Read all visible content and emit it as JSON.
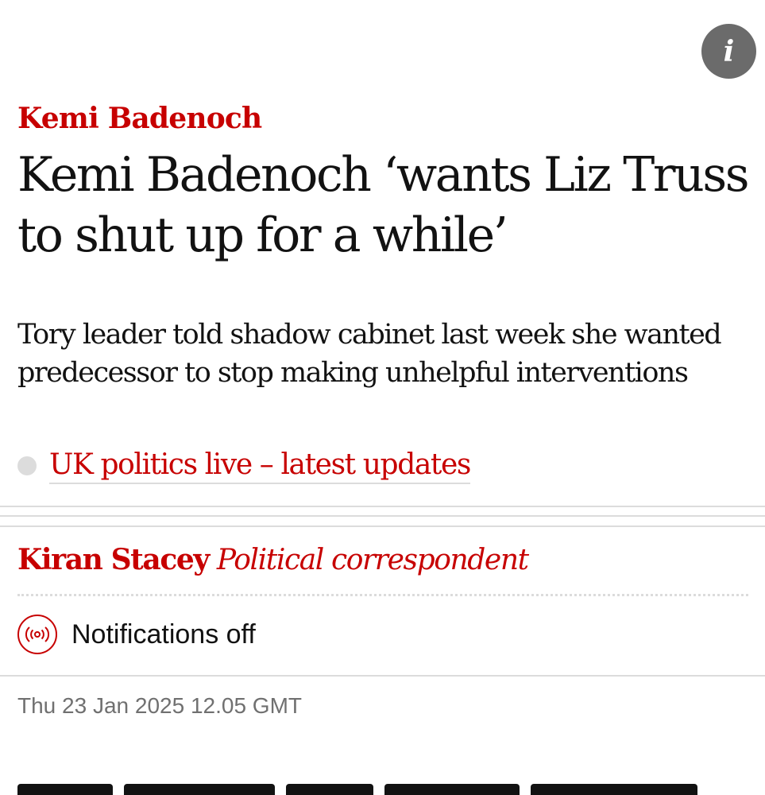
{
  "info_button": {
    "label": "i",
    "icon": "info-icon"
  },
  "article": {
    "kicker": "Kemi Badenoch",
    "headline": "Kemi Badenoch ‘wants Liz Truss to shut up for a while’",
    "standfirst": "Tory leader told shadow cabinet last week she wanted predecessor to stop making unhelpful interventions",
    "related_link": "UK politics live – latest updates",
    "byline": {
      "author": "Kiran Stacey",
      "role": "Political correspondent"
    },
    "notifications": {
      "label": "Notifications off",
      "icon": "broadcast-icon"
    },
    "dateline": "Thu 23 Jan 2025 12.05 GMT"
  },
  "colors": {
    "accent": "#c70000",
    "text": "#121212",
    "muted": "#707070",
    "rule": "#dcdcdc",
    "info_bg": "#6b6b6b"
  }
}
